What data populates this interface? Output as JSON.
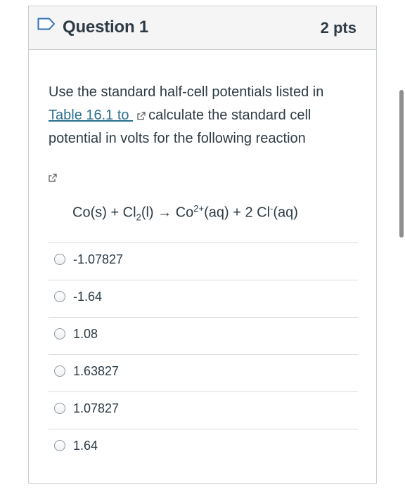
{
  "question": {
    "title": "Question 1",
    "points": "2 pts"
  },
  "prompt": {
    "text_before": "Use the standard half-cell potentials listed in",
    "link_text": "Table 16.1 to ",
    "text_after": "calculate the standard cell potential in volts for the following reaction"
  },
  "equation": {
    "left": "Co(s) + Cl",
    "cl_subscript": "2",
    "middle": "(l) → Co",
    "co_superscript": "2+",
    "right_a": "(aq) + 2 Cl",
    "cl_superscript": "-",
    "right_b": "(aq)"
  },
  "answers": [
    {
      "label": "-1.07827"
    },
    {
      "label": "-1.64"
    },
    {
      "label": "1.08"
    },
    {
      "label": "1.63827"
    },
    {
      "label": "1.07827"
    },
    {
      "label": "1.64"
    }
  ],
  "icons": {
    "flag": "bookmark-flag-icon",
    "external_link": "external-link-icon"
  },
  "colors": {
    "header_bg": "#f5f5f5",
    "border": "#c7cdd1",
    "link": "#2a6f90",
    "flag": "#2a6fb7",
    "text": "#2d3b45"
  }
}
